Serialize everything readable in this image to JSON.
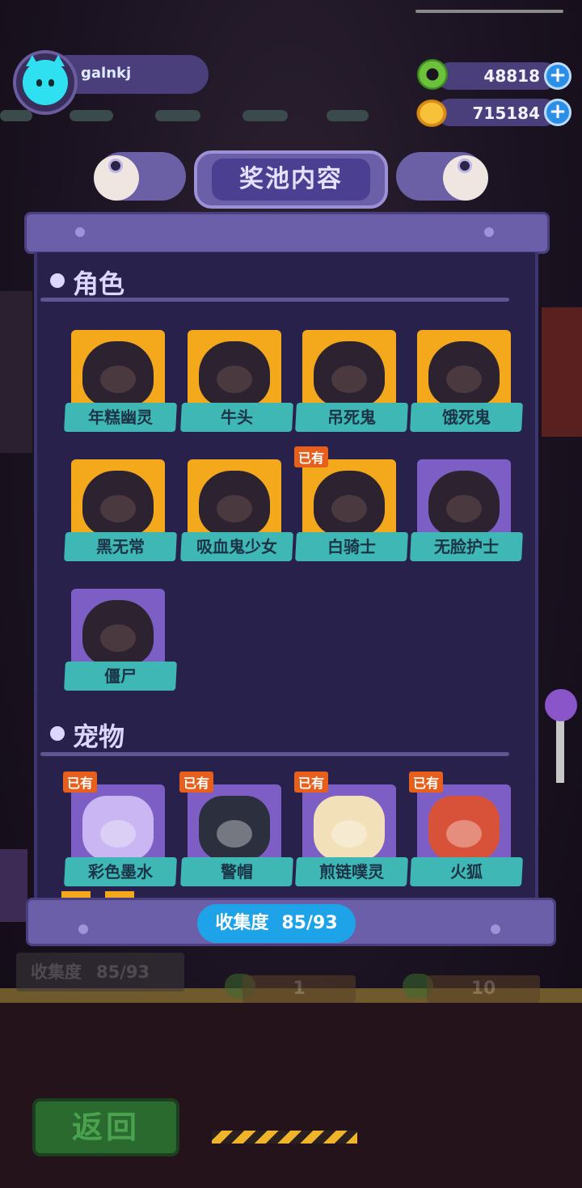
{
  "header": {
    "username": "galnkj",
    "currency1_value": "48818",
    "currency1_icon": "green-donut-icon",
    "currency2_value": "715184",
    "currency2_icon": "golden-planet-icon",
    "plus_symbol": "+"
  },
  "panel": {
    "title": "奖池内容",
    "owned_tag": "已有",
    "sections": [
      {
        "title": "角色",
        "items": [
          {
            "label": "年糕幽灵",
            "owned": false,
            "rarity": "gold"
          },
          {
            "label": "牛头",
            "owned": false,
            "rarity": "gold"
          },
          {
            "label": "吊死鬼",
            "owned": false,
            "rarity": "gold"
          },
          {
            "label": "饿死鬼",
            "owned": false,
            "rarity": "gold"
          },
          {
            "label": "黑无常",
            "owned": false,
            "rarity": "gold"
          },
          {
            "label": "吸血鬼少女",
            "owned": false,
            "rarity": "gold"
          },
          {
            "label": "白骑士",
            "owned": true,
            "rarity": "gold"
          },
          {
            "label": "无脸护士",
            "owned": false,
            "rarity": "purple"
          },
          {
            "label": "僵尸",
            "owned": false,
            "rarity": "purple"
          }
        ]
      },
      {
        "title": "宠物",
        "items": [
          {
            "label": "彩色墨水",
            "owned": true,
            "rarity": "purple"
          },
          {
            "label": "警帽",
            "owned": true,
            "rarity": "purple"
          },
          {
            "label": "煎链噗灵",
            "owned": true,
            "rarity": "purple"
          },
          {
            "label": "火狐",
            "owned": true,
            "rarity": "purple"
          }
        ]
      }
    ],
    "collection_label": "收集度",
    "collection_value": "85/93"
  },
  "machine": {
    "collection_label": "收集度",
    "collection_value": "85/93",
    "cost_single": "1",
    "cost_multi": "10",
    "back_label": "返回"
  },
  "colors": {
    "gold_tile": "#f4a91d",
    "purple_tile": "#7c5ec4",
    "label_teal": "#3fb7b5",
    "owned_orange": "#e65f1d",
    "panel_bg": "#27214b",
    "collect_blue": "#1fa3e8"
  }
}
